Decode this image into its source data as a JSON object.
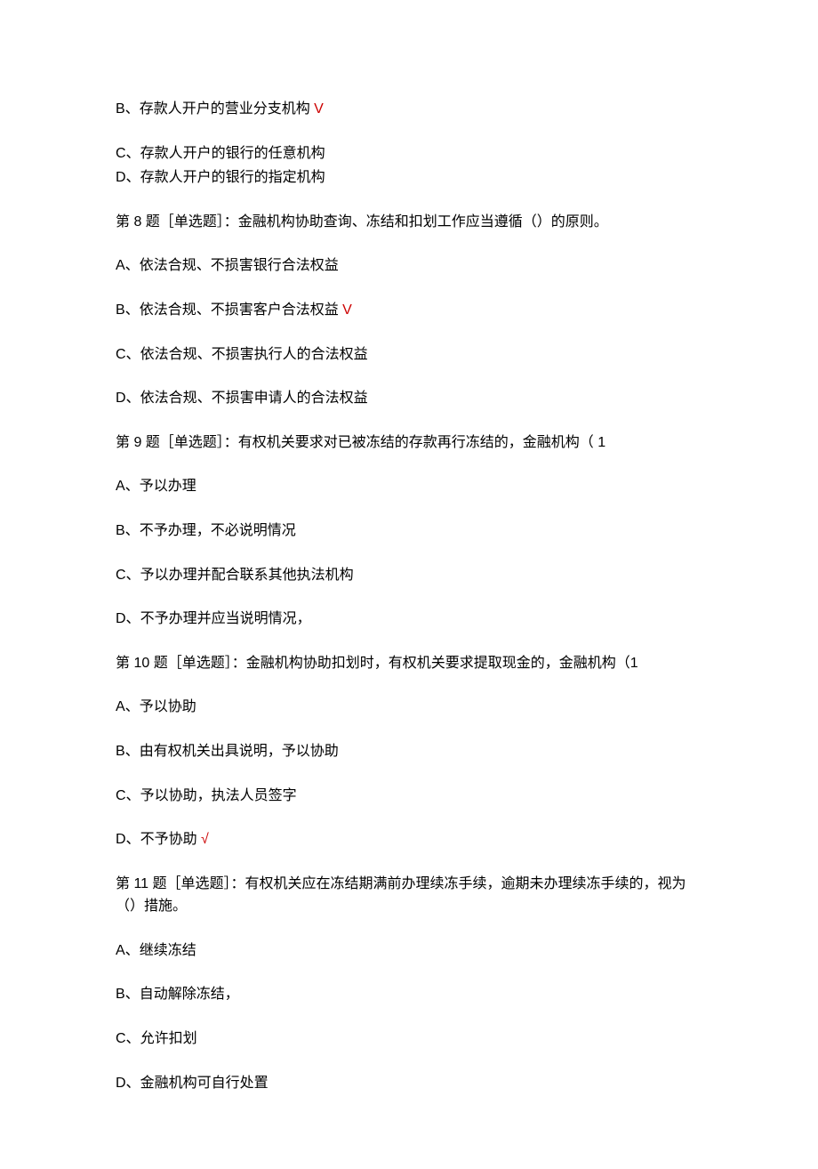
{
  "q7_fragment": {
    "options": [
      {
        "letter": "B、",
        "text": "存款人开户的营业分支机构",
        "correct": true
      },
      {
        "letter": "C、",
        "text": "存款人开户的银行的任意机构",
        "correct": false
      },
      {
        "letter": "D、",
        "text": "存款人开户的银行的指定机构",
        "correct": false
      }
    ]
  },
  "q8": {
    "stem": "第 8 题［单选题］：金融机构协助查询、冻结和扣划工作应当遵循（）的原则。",
    "options": [
      {
        "letter": "A、",
        "text": "依法合规、不损害银行合法权益",
        "correct": false
      },
      {
        "letter": "B、",
        "text": "依法合规、不损害客户合法权益",
        "correct": true
      },
      {
        "letter": "C、",
        "text": "依法合规、不损害执行人的合法权益",
        "correct": false
      },
      {
        "letter": "D、",
        "text": "依法合规、不损害申请人的合法权益",
        "correct": false
      }
    ]
  },
  "q9": {
    "stem": "第 9 题［单选题］：有权机关要求对已被冻结的存款再行冻结的，金融机构（ 1",
    "options": [
      {
        "letter": "A、",
        "text": "予以办理",
        "correct": false
      },
      {
        "letter": "B、",
        "text": "不予办理，不必说明情况",
        "correct": false
      },
      {
        "letter": "C、",
        "text": "予以办理并配合联系其他执法机构",
        "correct": false
      },
      {
        "letter": "D、",
        "text": "不予办理并应当说明情况，",
        "correct": false
      }
    ]
  },
  "q10": {
    "stem": "第 10 题［单选题］：金融机构协助扣划时，有权机关要求提取现金的，金融机构（1",
    "options": [
      {
        "letter": "A、",
        "text": "予以协助",
        "correct": false
      },
      {
        "letter": "B、",
        "text": "由有权机关出具说明，予以协助",
        "correct": false
      },
      {
        "letter": "C、",
        "text": "予以协助，执法人员签字",
        "correct": false
      },
      {
        "letter": "D、",
        "text": "不予协助",
        "correct": true
      }
    ]
  },
  "q11": {
    "stem": "第 11 题［单选题］：有权机关应在冻结期满前办理续冻手续，逾期未办理续冻手续的，视为（）措施。",
    "options": [
      {
        "letter": "A、",
        "text": "继续冻结",
        "correct": false
      },
      {
        "letter": "B、",
        "text": "自动解除冻结，",
        "correct": false
      },
      {
        "letter": "C、",
        "text": "允许扣划",
        "correct": false
      },
      {
        "letter": "D、",
        "text": "金融机构可自行处置",
        "correct": false
      }
    ]
  },
  "correct_mark_V": " V",
  "correct_mark_check": " √"
}
